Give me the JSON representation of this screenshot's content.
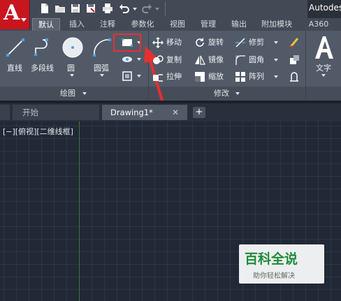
{
  "app": {
    "logo_letter": "A",
    "title": "Autodes"
  },
  "ribbon_tabs": [
    "默认",
    "插入",
    "注释",
    "参数化",
    "视图",
    "管理",
    "输出",
    "附加模块",
    "A360"
  ],
  "draw_panel": {
    "buttons": [
      "直线",
      "多段线",
      "圆",
      "圆弧"
    ],
    "label": "绘图"
  },
  "modify_panel": {
    "commands": [
      "移动",
      "旋转",
      "修剪",
      "复制",
      "镜像",
      "圆角",
      "拉伸",
      "缩放",
      "阵列"
    ],
    "label": "修改"
  },
  "text_panel": {
    "label": "文字"
  },
  "doc_tabs": [
    "开始",
    "Drawing1*"
  ],
  "viewport": {
    "label": "[−][俯视][二维线框]"
  },
  "watermark": {
    "title": "百科全说",
    "subtitle": "助你轻松解决"
  },
  "colors": {
    "accent": "#c8151e",
    "highlight": "#e63030",
    "brand_green": "#1f8a3a"
  }
}
